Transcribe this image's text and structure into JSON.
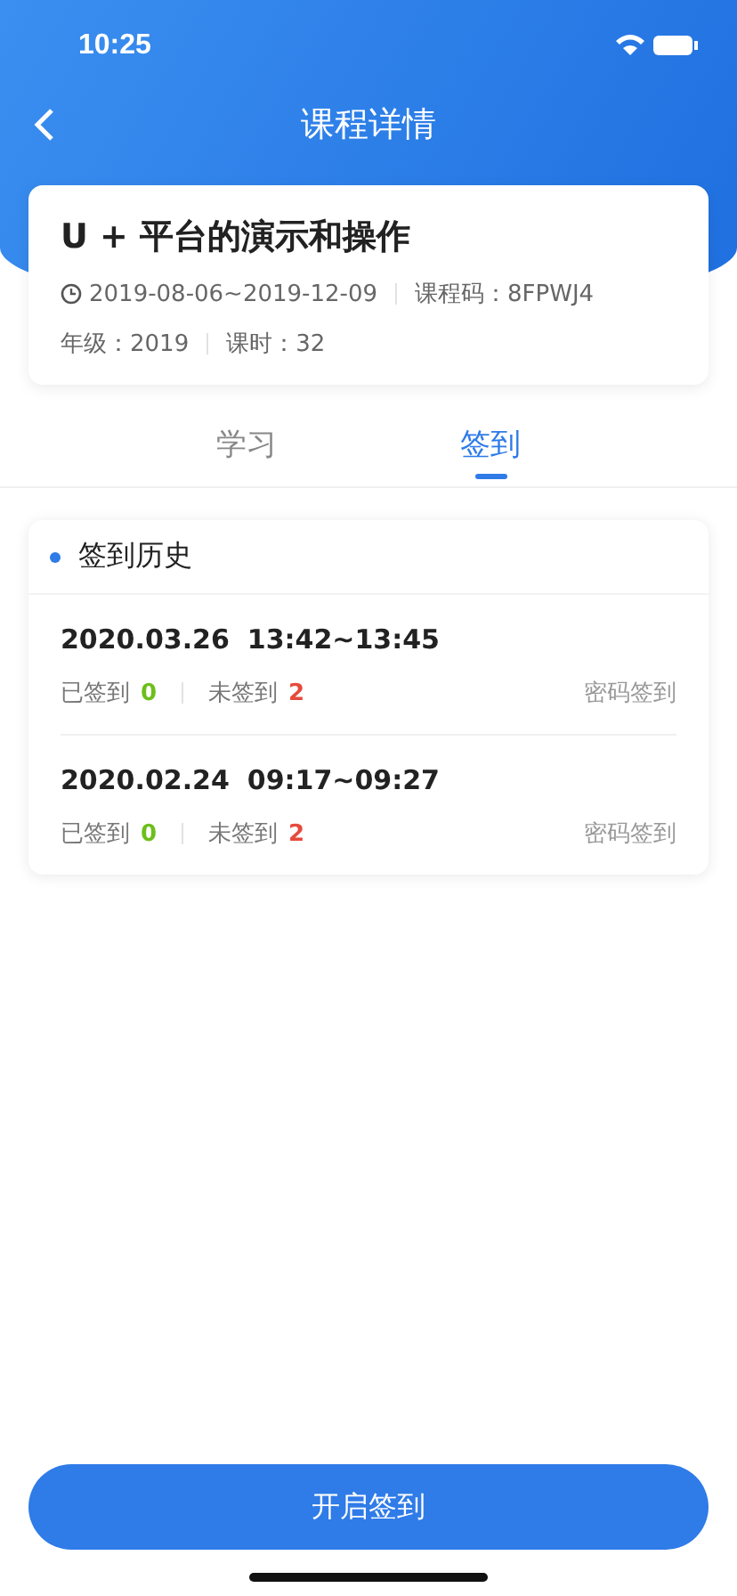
{
  "status_bar": {
    "time": "10:25"
  },
  "nav": {
    "title": "课程详情"
  },
  "course": {
    "title": "U + 平台的演示和操作",
    "dates": "2019-08-06~2019-12-09",
    "code_label": "课程码：",
    "code": "8FPWJ4",
    "grade_label": "年级：",
    "grade": "2019",
    "hours_label": "课时：",
    "hours": "32"
  },
  "tabs": [
    {
      "label": "学习",
      "selected": false
    },
    {
      "label": "签到",
      "selected": true
    }
  ],
  "history": {
    "title": "签到历史",
    "records": [
      {
        "date": "2020.03.26",
        "time": "13:42~13:45",
        "signed_label": "已签到",
        "signed": "0",
        "unsigned_label": "未签到",
        "unsigned": "2",
        "method": "密码签到"
      },
      {
        "date": "2020.02.24",
        "time": "09:17~09:27",
        "signed_label": "已签到",
        "signed": "0",
        "unsigned_label": "未签到",
        "unsigned": "2",
        "method": "密码签到"
      }
    ]
  },
  "start_button": "开启签到"
}
